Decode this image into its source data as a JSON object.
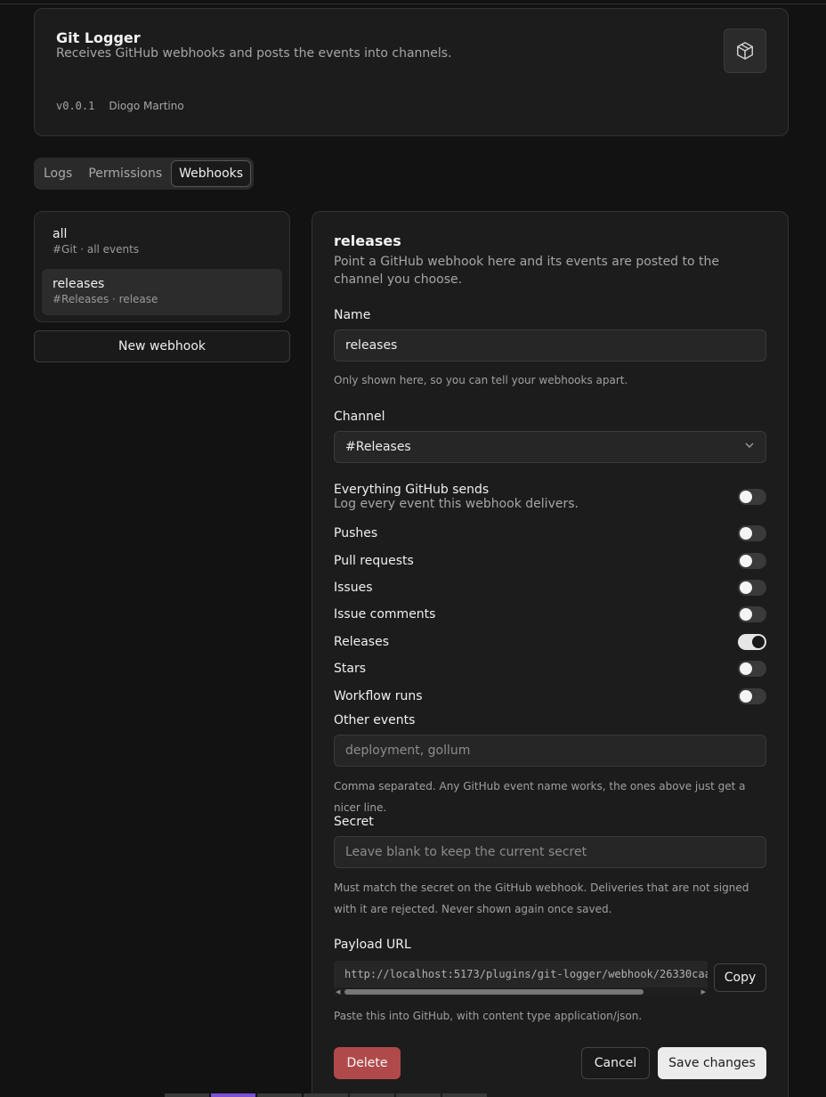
{
  "plugin": {
    "name": "Git Logger",
    "description": "Receives GitHub webhooks and posts the events into channels.",
    "version": "v0.0.1",
    "author": "Diogo Martino",
    "icon": "package-icon"
  },
  "tabs": [
    {
      "label": "Logs",
      "active": false
    },
    {
      "label": "Permissions",
      "active": false
    },
    {
      "label": "Webhooks",
      "active": true
    }
  ],
  "webhooks": [
    {
      "name": "all",
      "subtitle": "#Git · all events",
      "active": false
    },
    {
      "name": "releases",
      "subtitle": "#Releases · release",
      "active": true
    }
  ],
  "new_webhook_label": "New webhook",
  "detail": {
    "title": "releases",
    "description": "Point a GitHub webhook here and its events are posted to the channel you choose.",
    "name_label": "Name",
    "name_value": "releases",
    "name_help": "Only shown here, so you can tell your webhooks apart.",
    "channel_label": "Channel",
    "channel_value": "#Releases",
    "everything_label": "Everything GitHub sends",
    "everything_desc": "Log every event this webhook delivers.",
    "everything_on": false,
    "events": [
      {
        "label": "Pushes",
        "on": false
      },
      {
        "label": "Pull requests",
        "on": false
      },
      {
        "label": "Issues",
        "on": false
      },
      {
        "label": "Issue comments",
        "on": false
      },
      {
        "label": "Releases",
        "on": true
      },
      {
        "label": "Stars",
        "on": false
      },
      {
        "label": "Workflow runs",
        "on": false
      }
    ],
    "other_label": "Other events",
    "other_placeholder": "deployment, gollum",
    "other_help": "Comma separated. Any GitHub event name works, the ones above just get a nicer line.",
    "secret_label": "Secret",
    "secret_placeholder": "Leave blank to keep the current secret",
    "secret_help": "Must match the secret on the GitHub webhook. Deliveries that are not signed with it are rejected. Never shown again once saved.",
    "payload_label": "Payload URL",
    "payload_url": "http://localhost:5173/plugins/git-logger/webhook/26330caa",
    "copy_label": "Copy",
    "payload_help": "Paste this into GitHub, with content type application/json.",
    "delete_label": "Delete",
    "cancel_label": "Cancel",
    "save_label": "Save changes"
  },
  "colors": {
    "background": "#121212",
    "card": "#1c1c1c",
    "danger": "#b04a4a",
    "primary_button": "#ececec"
  }
}
